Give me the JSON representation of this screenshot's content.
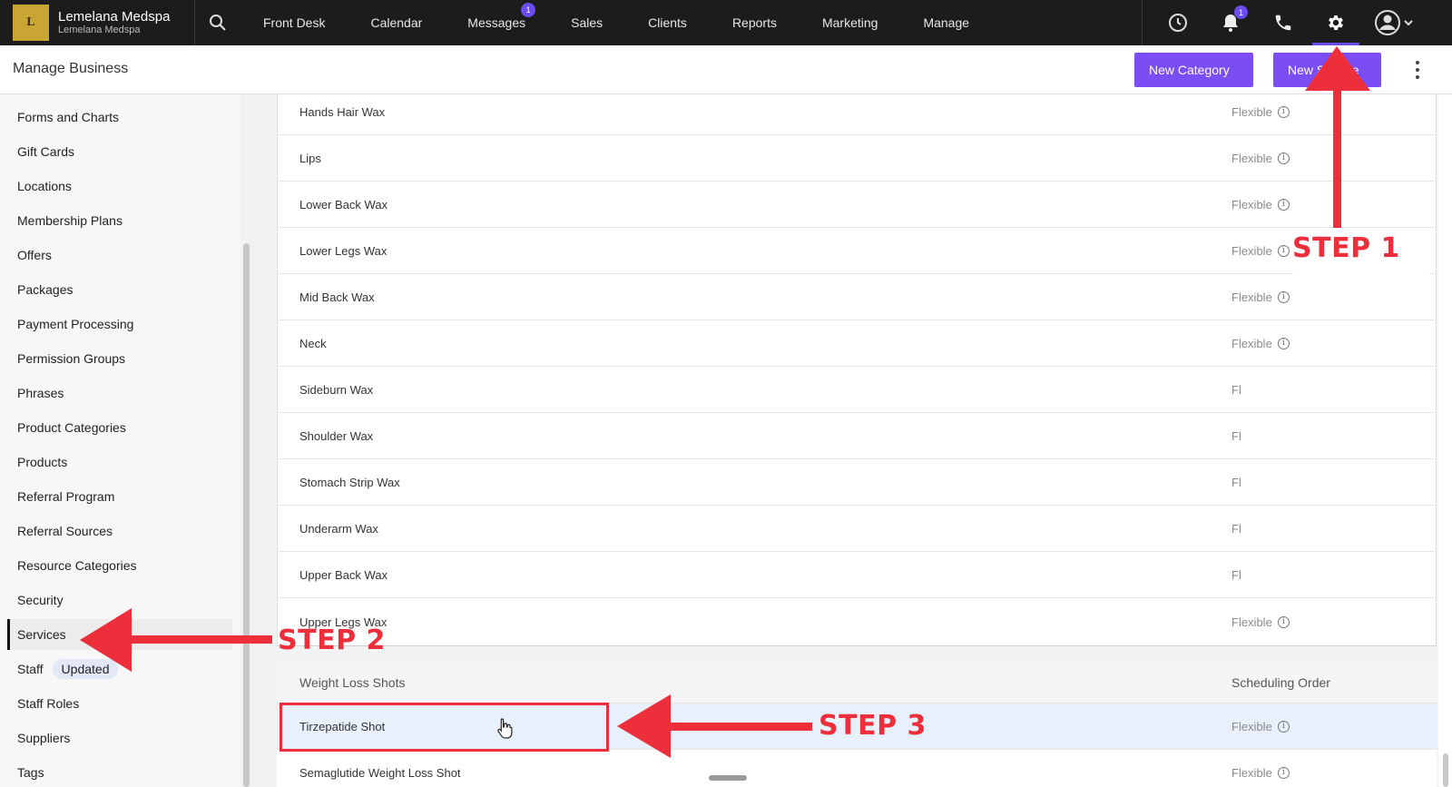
{
  "topbar": {
    "brand_name": "Lemelana Medspa",
    "brand_sub": "Lemelana Medspa",
    "nav": [
      "Front Desk",
      "Calendar",
      "Messages",
      "Sales",
      "Clients",
      "Reports",
      "Marketing",
      "Manage"
    ],
    "messages_badge": "1",
    "notifications_badge": "1"
  },
  "subheader": {
    "title": "Manage Business",
    "new_category": "New Category",
    "new_service": "New Service"
  },
  "sidebar": {
    "items": [
      "Forms and Charts",
      "Gift Cards",
      "Locations",
      "Membership Plans",
      "Offers",
      "Packages",
      "Payment Processing",
      "Permission Groups",
      "Phrases",
      "Product Categories",
      "Products",
      "Referral Program",
      "Referral Sources",
      "Resource Categories",
      "Security",
      "Services",
      "Staff",
      "Staff Roles",
      "Suppliers",
      "Tags"
    ],
    "active": "Services",
    "staff_pill": "Updated"
  },
  "services": {
    "rows": [
      {
        "name": "Hands Hair Wax",
        "order": "Flexible"
      },
      {
        "name": "Lips",
        "order": "Flexible"
      },
      {
        "name": "Lower Back Wax",
        "order": "Flexible"
      },
      {
        "name": "Lower Legs Wax",
        "order": "Flexible"
      },
      {
        "name": "Mid Back Wax",
        "order": "Flexible"
      },
      {
        "name": "Neck",
        "order": "Flexible"
      },
      {
        "name": "Sideburn Wax",
        "order": "Fl"
      },
      {
        "name": "Shoulder Wax",
        "order": "Fl"
      },
      {
        "name": "Stomach Strip Wax",
        "order": "Fl"
      },
      {
        "name": "Underarm Wax",
        "order": "Fl"
      },
      {
        "name": "Upper Back Wax",
        "order": "Fl"
      },
      {
        "name": "Upper Legs Wax",
        "order": "Flexible"
      }
    ],
    "category2": {
      "name": "Weight Loss Shots",
      "col": "Scheduling Order",
      "rows": [
        {
          "name": "Tirzepatide Shot",
          "order": "Flexible"
        },
        {
          "name": "Semaglutide Weight Loss Shot",
          "order": "Flexible"
        }
      ]
    }
  },
  "annotations": {
    "step1": "STEP 1",
    "step2": "STEP 2",
    "step3": "STEP 3"
  }
}
